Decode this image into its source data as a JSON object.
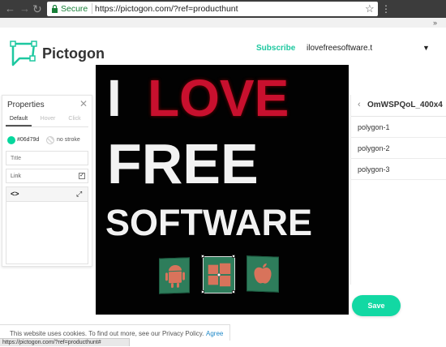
{
  "browser": {
    "secure_label": "Secure",
    "url": "https://pictogon.com/?ref=producthunt",
    "status_url": "https://pictogon.com/?ref=producthunt#"
  },
  "header": {
    "brand": "Pictogon",
    "subscribe_label": "Subscribe",
    "user_label": "ilovefreesoftware.t",
    "accent_color": "#1ec8a0"
  },
  "properties": {
    "title": "Properties",
    "tabs": [
      "Default",
      "Hover",
      "Click"
    ],
    "fill_hex": "#06d79d",
    "stroke_label": "no stroke",
    "title_placeholder": "Title",
    "link_label": "Link",
    "link_checked": true
  },
  "canvas": {
    "line1_a": "I",
    "line1_b": "LOVE",
    "line2": "FREE",
    "line3": "SOFTWARE"
  },
  "layers": {
    "title": "OmWSPQoL_400x4",
    "items": [
      "polygon-1",
      "polygon-2",
      "polygon-3"
    ]
  },
  "save_label": "Save",
  "cookie": {
    "text": "This website uses cookies. To find out more, see our Privacy Policy.",
    "agree_label": "Agree"
  },
  "icons": [
    "back-arrow-icon",
    "forward-arrow-icon",
    "reload-icon",
    "lock-icon",
    "star-icon",
    "logo-icon",
    "close-icon",
    "code-icon",
    "expand-icon",
    "chevron-left-icon",
    "android-icon",
    "windows-icon",
    "apple-icon"
  ]
}
